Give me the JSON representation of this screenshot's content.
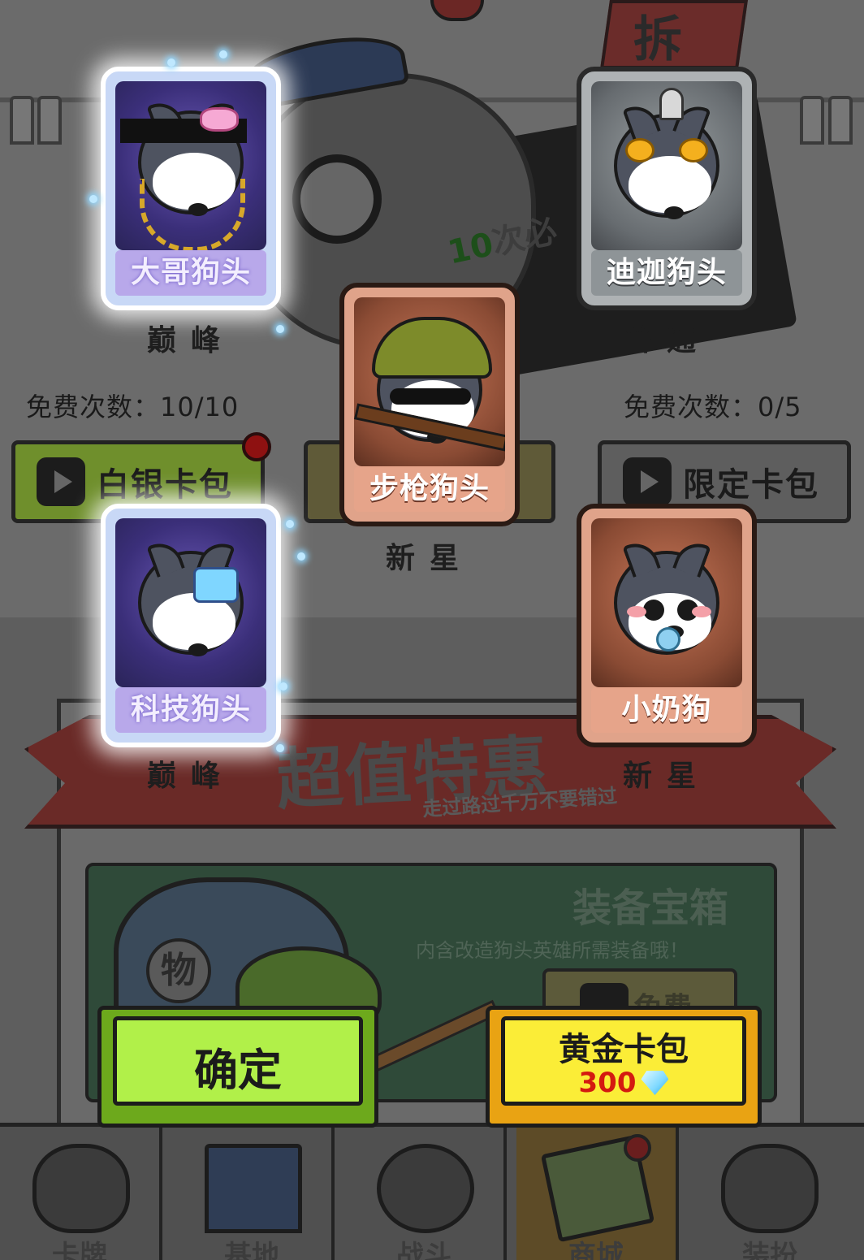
{
  "background": {
    "banner_char": "拆",
    "sign_text_num": "10",
    "sign_text": "次必",
    "promo_title": "超值特惠",
    "promo_subtitle": "走过路过千万不要错过",
    "chest_title": "装备宝箱",
    "chest_desc": "内含改造狗头英雄所需装备哦！",
    "chest_icon_char": "物",
    "chest_free_label": "免费"
  },
  "free_counts": {
    "silver": "免费次数：10/10",
    "limited": "免费次数：0/5"
  },
  "packs": {
    "silver_label": "白银卡包",
    "limited_label": "限定卡包"
  },
  "cards": [
    {
      "name": "大哥狗头",
      "rarity": "巅峰",
      "tier": "peak"
    },
    {
      "name": "迪迦狗头",
      "rarity": "普通",
      "tier": "normal"
    },
    {
      "name": "步枪狗头",
      "rarity": "新星",
      "tier": "star"
    },
    {
      "name": "科技狗头",
      "rarity": "巅峰",
      "tier": "peak"
    },
    {
      "name": "小奶狗",
      "rarity": "新星",
      "tier": "star"
    }
  ],
  "actions": {
    "confirm_label": "确定",
    "gold_pack_label": "黄金卡包",
    "gold_pack_price": "300",
    "price_icon": "diamond-icon"
  },
  "nav": [
    {
      "label": "卡牌",
      "icon": "dog-head-icon"
    },
    {
      "label": "基地",
      "icon": "castle-icon"
    },
    {
      "label": "战斗",
      "icon": "paw-icon"
    },
    {
      "label": "商城",
      "icon": "money-icon"
    },
    {
      "label": "装扮",
      "icon": "top-hat-icon"
    }
  ],
  "colors": {
    "confirm_button": "#b1f049",
    "gold_button": "#fbed37",
    "price_text": "#d41a10",
    "peak_card": "#c8d8f6",
    "star_card": "#e0a38a",
    "normal_card": "#aeb2b4"
  }
}
